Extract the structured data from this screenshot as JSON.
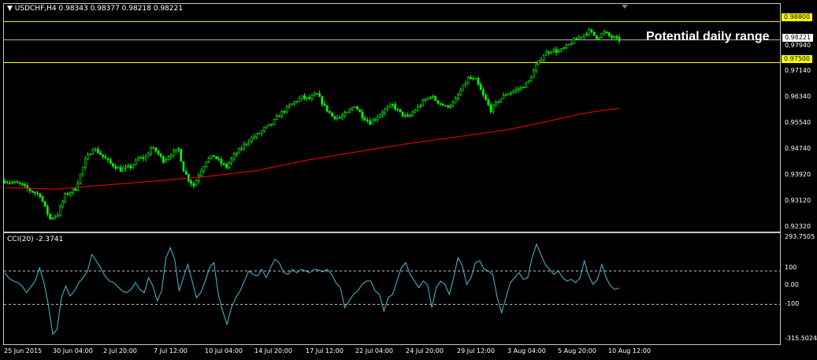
{
  "chart_data": [
    {
      "type": "candlestick",
      "symbol": "USDCHF",
      "timeframe": "H4",
      "header_label": "USDCHF,H4",
      "ohlc_label": "0.98343 0.98377 0.98218 0.98221",
      "current_price": "0.98221",
      "ylim": [
        0.9232,
        0.9906
      ],
      "y_ticks": [
        "0.98800",
        "0.97940",
        "0.97500",
        "0.97140",
        "0.96340",
        "0.95540",
        "0.94740",
        "0.93920",
        "0.93120",
        "0.92320"
      ],
      "x_ticks": [
        "25 Jun 2015",
        "30 Jun 04:00",
        "2 Jul 20:00",
        "7 Jul 12:00",
        "10 Jul 04:00",
        "14 Jul 20:00",
        "17 Jul 12:00",
        "22 Jul 04:00",
        "24 Jul 20:00",
        "29 Jul 12:00",
        "3 Aug 04:00",
        "5 Aug 20:00",
        "10 Aug 12:00"
      ],
      "levels": [
        {
          "label": "0.98800",
          "value": 0.988,
          "color": "#ffff00"
        },
        {
          "label": "0.97500",
          "value": 0.975,
          "color": "#ffff00"
        },
        {
          "label": "0.98221",
          "value": 0.98221,
          "color": "#b4b4b4"
        }
      ],
      "annotation": "Potential daily range",
      "close_path": [
        [
          0,
          0.9375
        ],
        [
          6,
          0.9365
        ],
        [
          10,
          0.9345
        ],
        [
          14,
          0.933
        ],
        [
          16,
          0.929
        ],
        [
          18,
          0.9255
        ],
        [
          21,
          0.927
        ],
        [
          24,
          0.933
        ],
        [
          28,
          0.935
        ],
        [
          32,
          0.944
        ],
        [
          35,
          0.948
        ],
        [
          38,
          0.946
        ],
        [
          42,
          0.943
        ],
        [
          46,
          0.941
        ],
        [
          50,
          0.942
        ],
        [
          53,
          0.9445
        ],
        [
          56,
          0.945
        ],
        [
          58,
          0.948
        ],
        [
          60,
          0.947
        ],
        [
          63,
          0.944
        ],
        [
          66,
          0.946
        ],
        [
          69,
          0.9475
        ],
        [
          71,
          0.941
        ],
        [
          73,
          0.938
        ],
        [
          75,
          0.936
        ],
        [
          77,
          0.9395
        ],
        [
          80,
          0.944
        ],
        [
          83,
          0.9455
        ],
        [
          86,
          0.943
        ],
        [
          88,
          0.942
        ],
        [
          91,
          0.9455
        ],
        [
          94,
          0.948
        ],
        [
          97,
          0.9505
        ],
        [
          100,
          0.952
        ],
        [
          103,
          0.954
        ],
        [
          106,
          0.9555
        ],
        [
          109,
          0.9585
        ],
        [
          112,
          0.9605
        ],
        [
          115,
          0.9625
        ],
        [
          118,
          0.964
        ],
        [
          121,
          0.9635
        ],
        [
          124,
          0.965
        ],
        [
          127,
          0.961
        ],
        [
          130,
          0.958
        ],
        [
          133,
          0.9575
        ],
        [
          136,
          0.959
        ],
        [
          139,
          0.9615
        ],
        [
          142,
          0.958
        ],
        [
          145,
          0.956
        ],
        [
          148,
          0.958
        ],
        [
          151,
          0.96
        ],
        [
          154,
          0.9615
        ],
        [
          157,
          0.959
        ],
        [
          160,
          0.9575
        ],
        [
          163,
          0.96
        ],
        [
          166,
          0.9625
        ],
        [
          169,
          0.9645
        ],
        [
          172,
          0.9625
        ],
        [
          175,
          0.961
        ],
        [
          178,
          0.962
        ],
        [
          181,
          0.966
        ],
        [
          184,
          0.97
        ],
        [
          187,
          0.9695
        ],
        [
          190,
          0.9645
        ],
        [
          193,
          0.96
        ],
        [
          196,
          0.963
        ],
        [
          199,
          0.965
        ],
        [
          202,
          0.966
        ],
        [
          205,
          0.967
        ],
        [
          208,
          0.969
        ],
        [
          211,
          0.974
        ],
        [
          214,
          0.9775
        ],
        [
          217,
          0.979
        ],
        [
          220,
          0.9785
        ],
        [
          223,
          0.98
        ],
        [
          226,
          0.982
        ],
        [
          229,
          0.9835
        ],
        [
          232,
          0.985
        ],
        [
          235,
          0.983
        ],
        [
          238,
          0.9845
        ],
        [
          241,
          0.983
        ],
        [
          244,
          0.9822
        ]
      ],
      "ma_path": [
        [
          0,
          0.9354
        ],
        [
          20,
          0.9349
        ],
        [
          40,
          0.9362
        ],
        [
          60,
          0.9375
        ],
        [
          80,
          0.9389
        ],
        [
          100,
          0.9408
        ],
        [
          120,
          0.9441
        ],
        [
          140,
          0.9468
        ],
        [
          160,
          0.9493
        ],
        [
          180,
          0.9515
        ],
        [
          200,
          0.9538
        ],
        [
          215,
          0.9563
        ],
        [
          230,
          0.959
        ],
        [
          244,
          0.9606
        ]
      ],
      "colors": {
        "bull": "#00ff00",
        "bear": "#00ff00",
        "ma": "#ff0000",
        "background": "#000000",
        "grid": "#c8c8c8"
      }
    },
    {
      "type": "line",
      "indicator": "CCI",
      "header_label": "CCI(20) -2.3741",
      "ylim": [
        -315.5024,
        293.7505
      ],
      "y_ticks": [
        "293.7505",
        "100",
        "0.00",
        "-100",
        "-315.5024"
      ],
      "levels": [
        100,
        -100
      ],
      "color": "#4fb8d6",
      "values": [
        90,
        55,
        40,
        30,
        10,
        -30,
        5,
        40,
        120,
        30,
        -100,
        -280,
        -250,
        -60,
        10,
        -50,
        -20,
        30,
        60,
        100,
        200,
        160,
        120,
        70,
        40,
        30,
        5,
        -20,
        -30,
        -10,
        30,
        -10,
        -30,
        60,
        10,
        -80,
        -20,
        180,
        240,
        170,
        -20,
        60,
        140,
        40,
        -60,
        -30,
        40,
        120,
        150,
        -40,
        -140,
        -220,
        -120,
        -60,
        -20,
        40,
        100,
        80,
        70,
        110,
        60,
        120,
        170,
        150,
        90,
        80,
        110,
        90,
        110,
        100,
        90,
        110,
        105,
        95,
        110,
        80,
        30,
        0,
        -120,
        -80,
        -40,
        -20,
        20,
        40,
        40,
        -20,
        -40,
        -140,
        -60,
        -40,
        40,
        120,
        150,
        80,
        40,
        0,
        40,
        20,
        -120,
        0,
        40,
        20,
        -40,
        60,
        180,
        130,
        20,
        60,
        150,
        160,
        110,
        100,
        80,
        -60,
        -150,
        -60,
        30,
        60,
        90,
        50,
        60,
        180,
        260,
        200,
        140,
        110,
        80,
        100,
        60,
        40,
        50,
        30,
        60,
        160,
        70,
        20,
        50,
        140,
        60,
        10,
        -10,
        -2.3741
      ]
    }
  ]
}
